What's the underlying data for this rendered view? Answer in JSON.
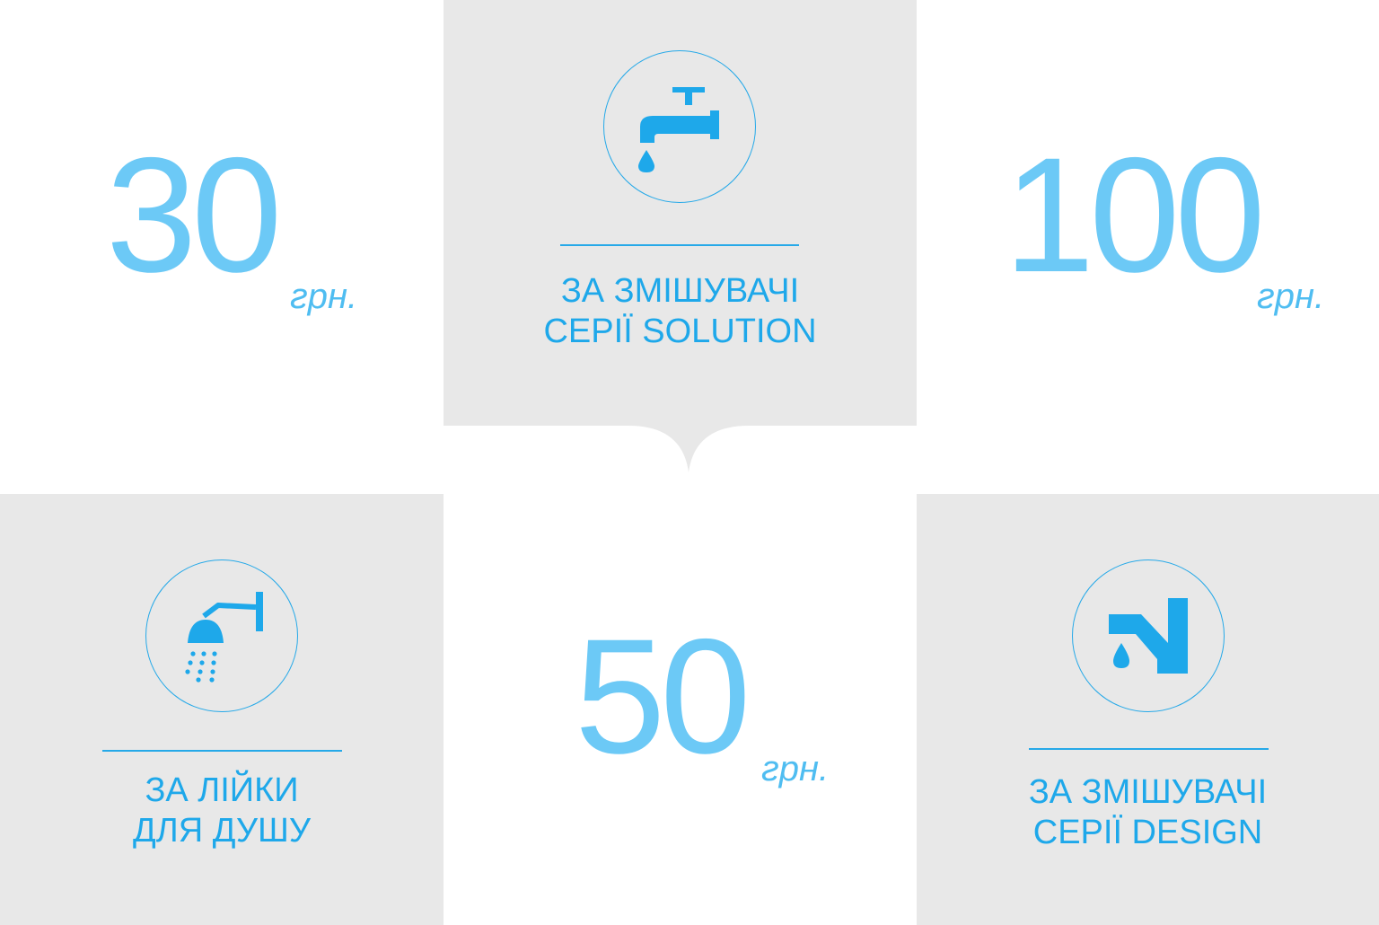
{
  "tiles": {
    "t1": {
      "price": "30",
      "unit": "грн."
    },
    "t2": {
      "line1": "ЗА ЗМІШУВАЧІ",
      "line2": "СЕРІЇ SOLUTION",
      "icon": "faucet-icon"
    },
    "t3": {
      "price": "100",
      "unit": "грн."
    },
    "t4": {
      "line1": "ЗА ЛІЙКИ",
      "line2": "ДЛЯ ДУШУ",
      "icon": "shower-head-icon"
    },
    "t5": {
      "price": "50",
      "unit": "грн."
    },
    "t6": {
      "line1": "ЗА ЗМІШУВАЧІ",
      "line2": "СЕРІЇ DESIGN",
      "icon": "mixer-tap-icon"
    }
  },
  "colors": {
    "price_text": "#6cc9f6",
    "accent_blue": "#1ea8ea",
    "tile_gray": "#e8e8e8",
    "tile_white": "#ffffff"
  }
}
